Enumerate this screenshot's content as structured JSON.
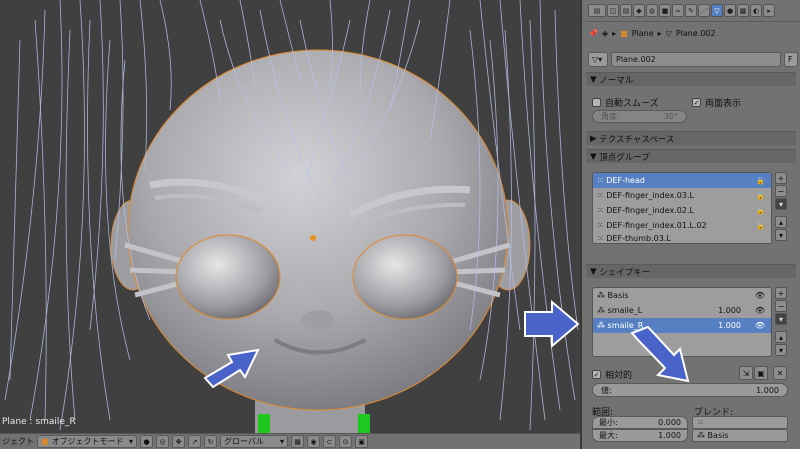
{
  "viewport": {
    "object_label": "Plane : smaile_R"
  },
  "header": {
    "editor_label": "ジェクト",
    "mode": "オブジェクトモード",
    "orientation": "グローバル"
  },
  "breadcrumb": {
    "object": "Plane",
    "mesh": "Plane.002"
  },
  "mesh_name": "Plane.002",
  "fake_user": "F",
  "normals": {
    "title": "ノーマル",
    "auto_smooth": "自動スムーズ",
    "double_sided": "両面表示",
    "angle_label": "角度:",
    "angle_value": "30°"
  },
  "texture_space": {
    "title": "テクスチャスペース"
  },
  "vertex_groups": {
    "title": "頂点グループ",
    "items": [
      "DEF-head",
      "DEF-finger_index.03.L",
      "DEF-finger_index.02.L",
      "DEF-finger_index.01.L.02",
      "DEF-thumb.03.L"
    ]
  },
  "shape_keys": {
    "title": "シェイプキー",
    "items": [
      {
        "name": "Basis",
        "value": ""
      },
      {
        "name": "smaile_L",
        "value": "1.000"
      },
      {
        "name": "smaile_R",
        "value": "1.000"
      }
    ],
    "relative": "相対的",
    "value_label": "値:",
    "value": "1.000",
    "range_label": "範囲:",
    "min_label": "最小:",
    "min_value": "0.000",
    "max_label": "最大:",
    "max_value": "1.000",
    "blend_label": "ブレンド:",
    "blend_value": "Basis"
  },
  "colors": {
    "selection": "#5680c2",
    "arrow": "#4a63c8",
    "hair": "#b8c1e8",
    "outline": "#e08a2a"
  }
}
